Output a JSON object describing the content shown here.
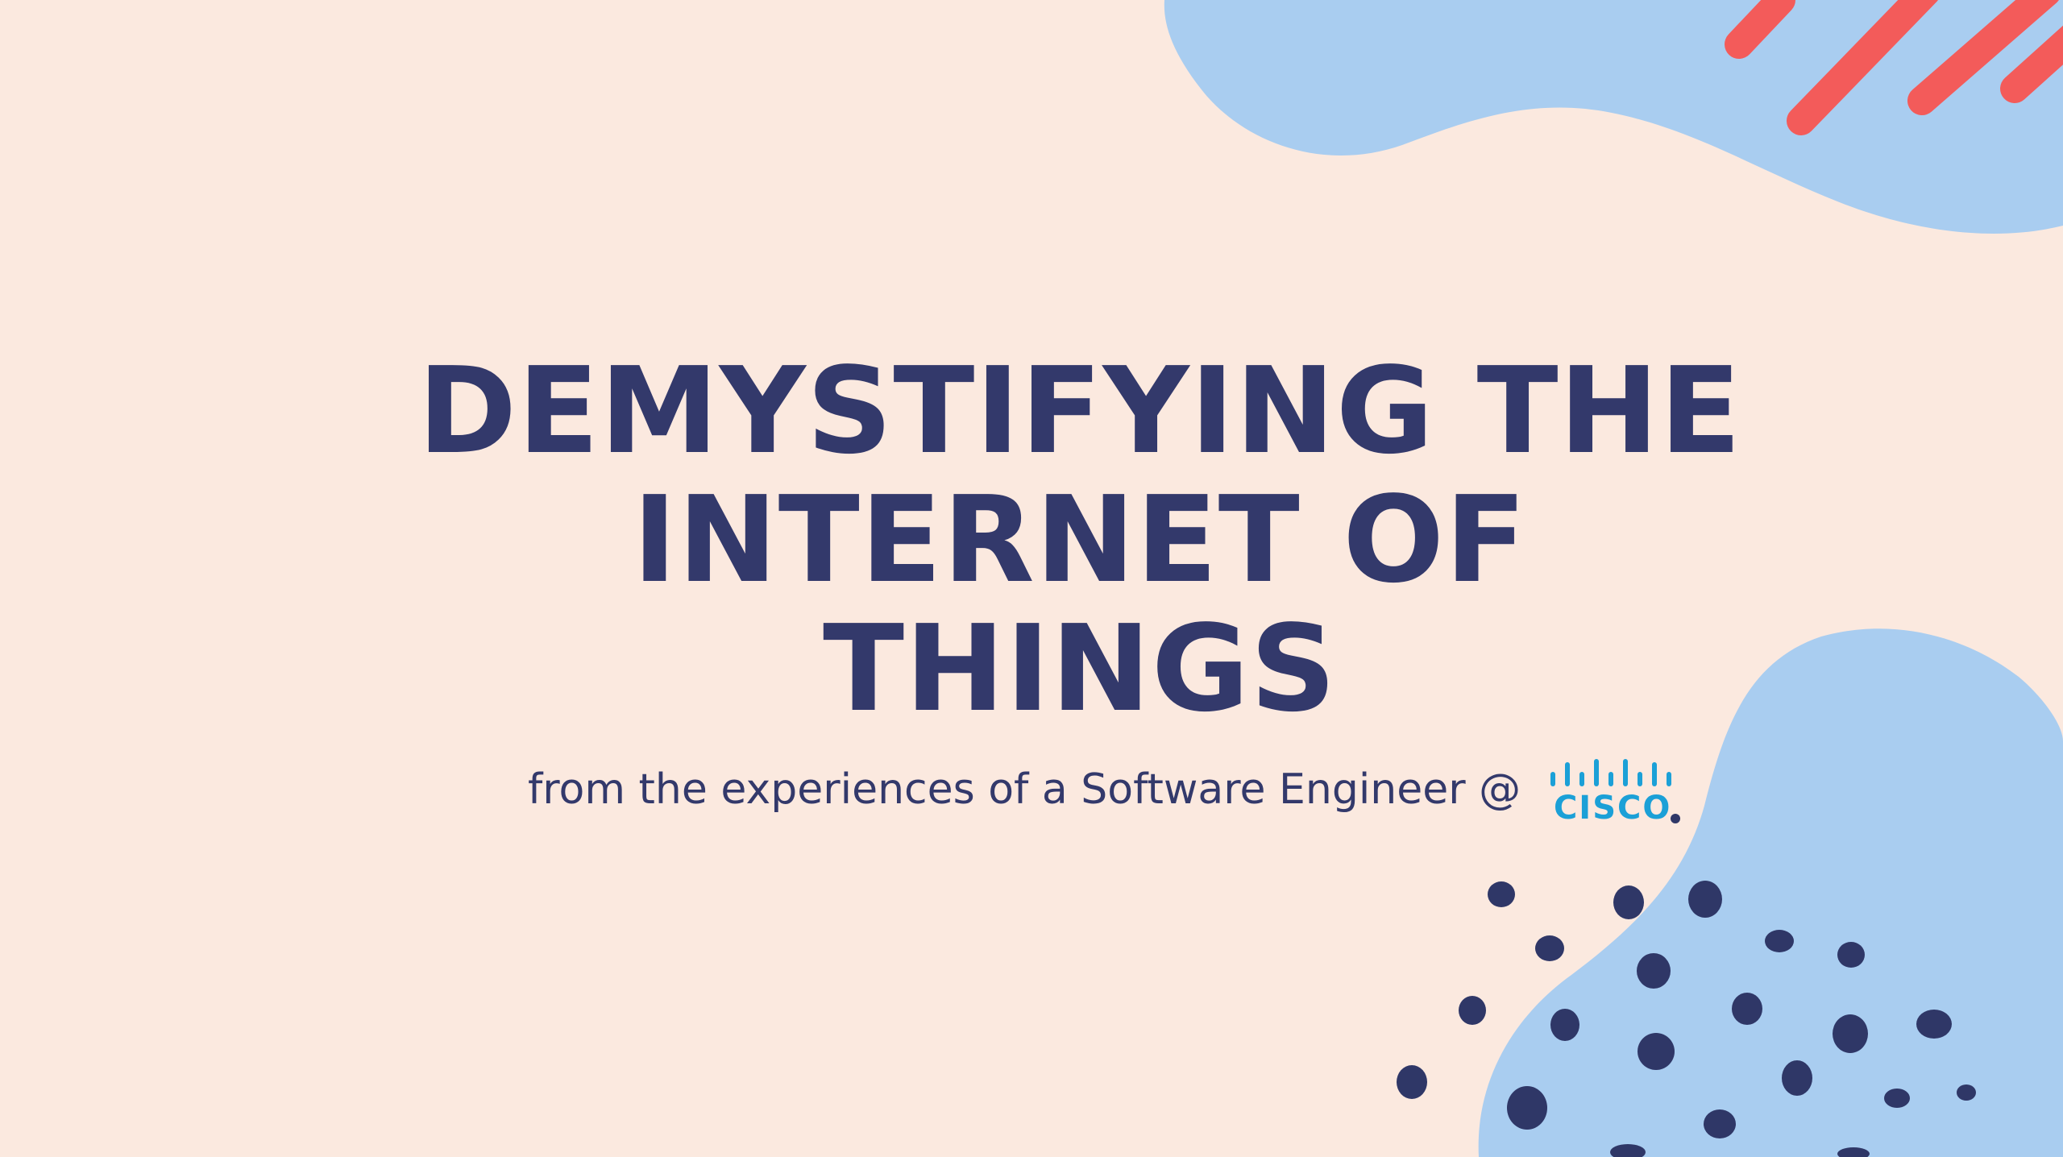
{
  "slide": {
    "title_lines": [
      "DEMYSTIFYING THE",
      "INTERNET OF",
      "THINGS"
    ],
    "subtitle": "from the experiences of a Software Engineer @",
    "logo": {
      "icon": "cisco-logo-icon",
      "wordmark": "cisco"
    }
  },
  "colors": {
    "background": "#fbe9df",
    "title": "#33396b",
    "blob": "#a9cdf0",
    "stripe": "#f35b5a",
    "dots": "#2f3767",
    "logo": "#1ba0d7"
  }
}
